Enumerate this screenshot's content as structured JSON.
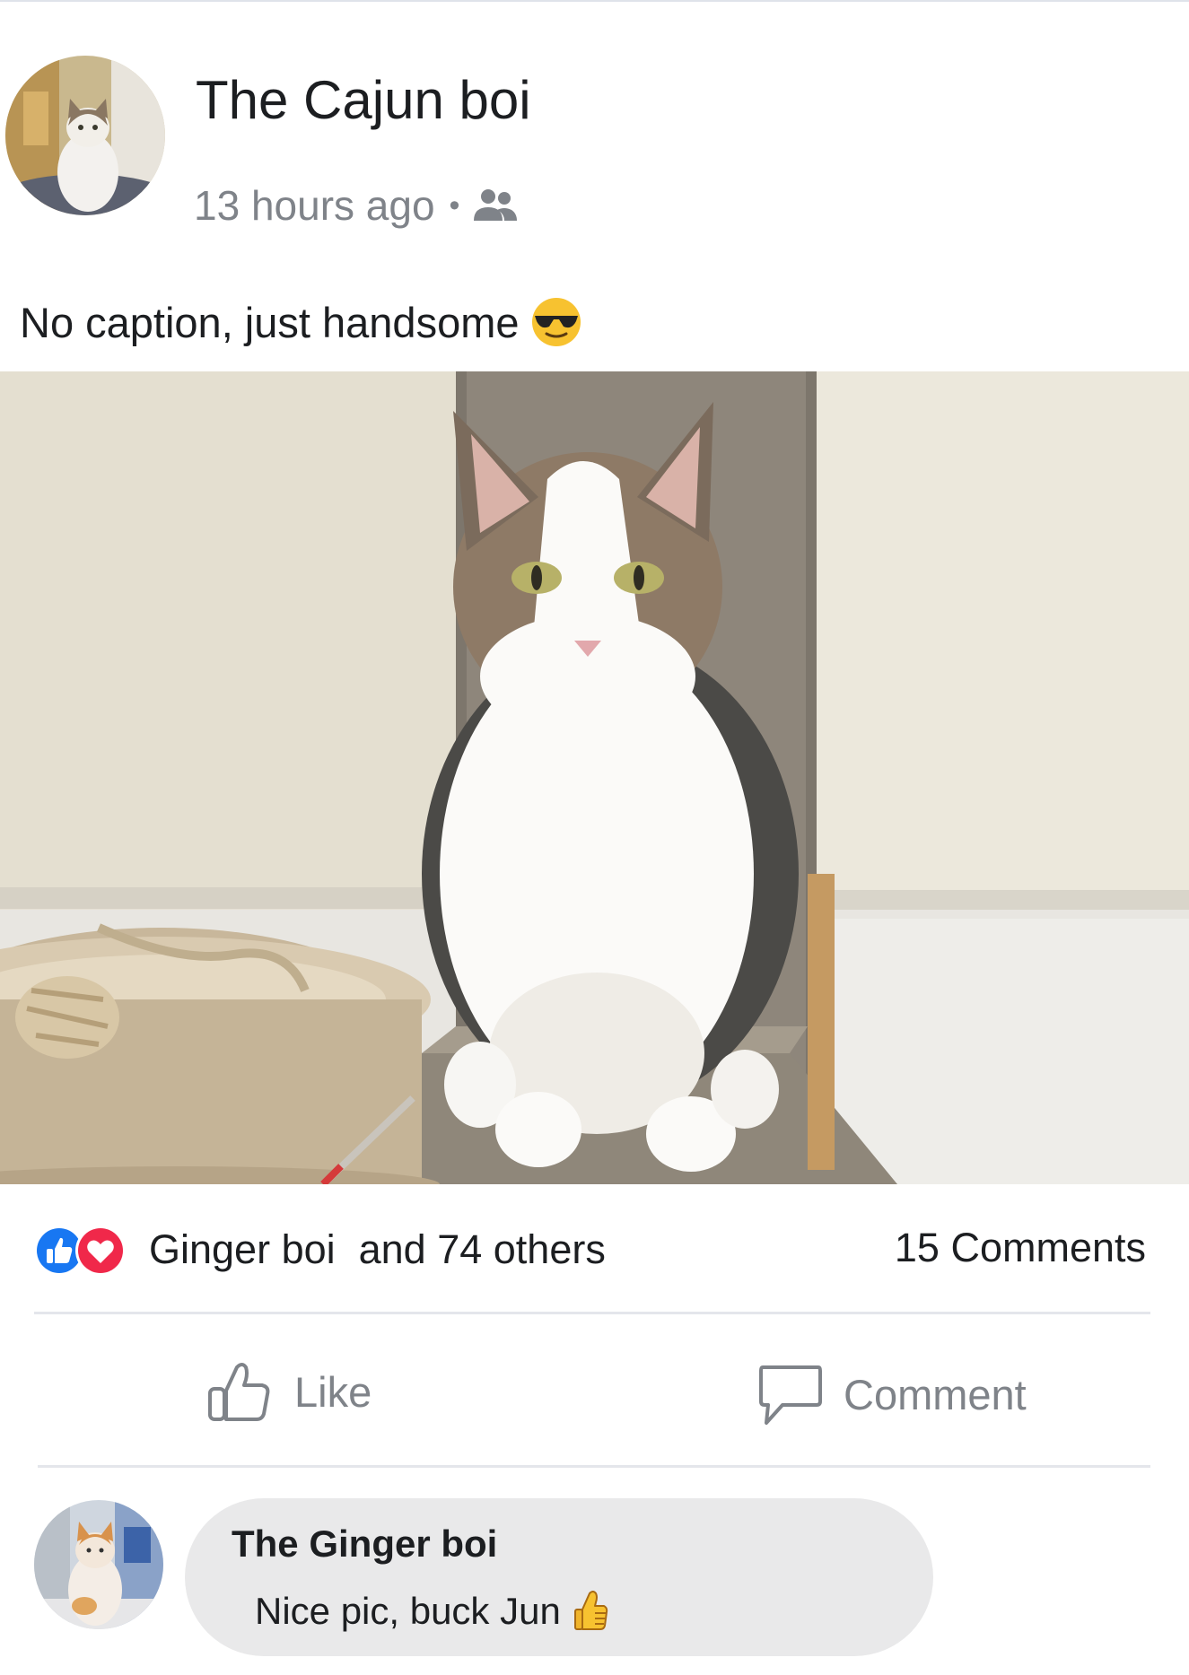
{
  "post": {
    "author": "The Cajun boi",
    "timestamp": "13 hours ago",
    "separator": "•",
    "audience_icon": "friends-icon",
    "caption": "No caption, just handsome",
    "caption_emoji": "smiling-face-with-sunglasses-icon",
    "photo_description": "cat-sitting-on-scratcher"
  },
  "reactions": {
    "icons": [
      "like-reaction-icon",
      "love-reaction-icon"
    ],
    "first_name": "Ginger boi",
    "others_text": "and 74 others",
    "comments_count": "15 Comments"
  },
  "actions": {
    "like_label": "Like",
    "comment_label": "Comment"
  },
  "comment": {
    "author": "The Ginger boi",
    "text": "Nice pic, buck Jun",
    "emoji": "thumbs-up-icon"
  },
  "colors": {
    "like_blue": "#1877f2",
    "love_red": "#f0284a",
    "muted_text": "#7f8389",
    "bubble_gray": "#e9e9ea"
  }
}
